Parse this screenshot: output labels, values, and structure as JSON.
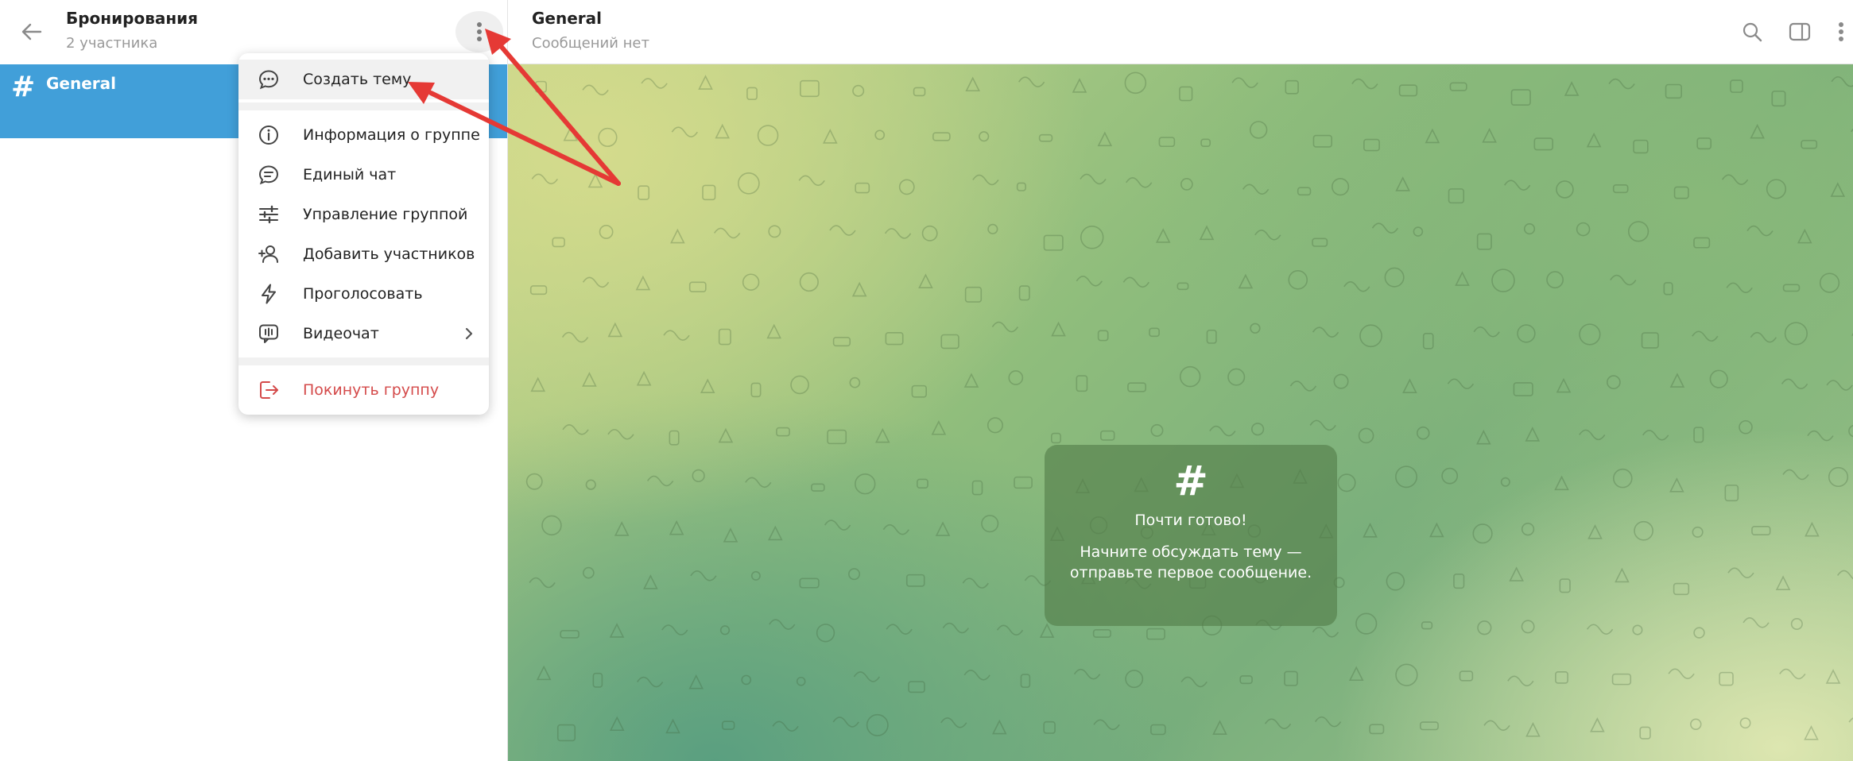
{
  "left": {
    "title": "Бронирования",
    "subtitle": "2 участника",
    "topics": [
      {
        "icon": "#",
        "name": "General"
      }
    ]
  },
  "menu": {
    "items": [
      {
        "label": "Создать тему",
        "icon": "chat-bubble-dots-icon"
      },
      {
        "label": "Информация о группе",
        "icon": "info-icon"
      },
      {
        "label": "Единый чат",
        "icon": "chat-bubble-lines-icon"
      },
      {
        "label": "Управление группой",
        "icon": "sliders-icon"
      },
      {
        "label": "Добавить участников",
        "icon": "add-user-icon"
      },
      {
        "label": "Проголосовать",
        "icon": "lightning-icon"
      },
      {
        "label": "Видеочат",
        "icon": "video-chat-icon"
      },
      {
        "label": "Покинуть группу",
        "icon": "leave-icon"
      }
    ]
  },
  "chat": {
    "title": "General",
    "subtitle": "Сообщений нет",
    "empty": {
      "icon": "#",
      "title": "Почти готово!",
      "text": "Начните обсуждать тему — отправьте первое сообщение."
    }
  },
  "colors": {
    "accent": "#419fd9",
    "danger": "#d44a4a",
    "annotation_arrow": "#e53935"
  }
}
